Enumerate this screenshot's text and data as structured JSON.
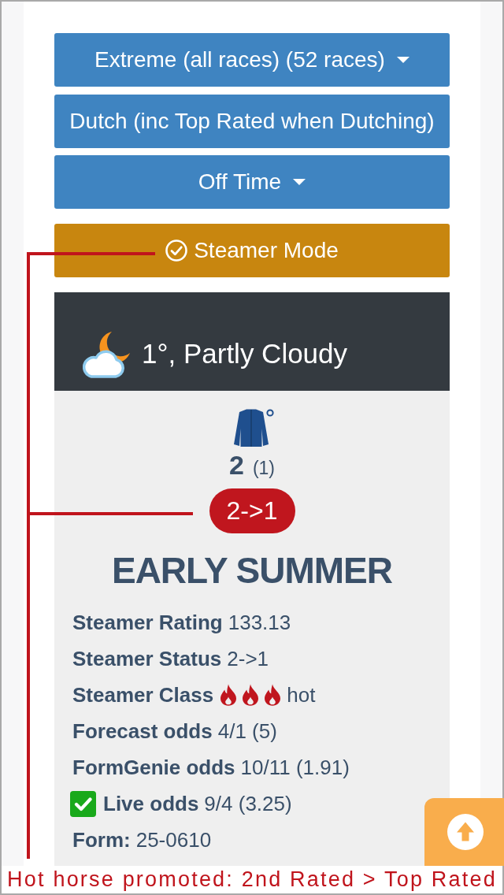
{
  "filters": [
    {
      "kind": "dropdown",
      "label": "Extreme (all races) (52 races)"
    },
    {
      "kind": "button",
      "label": "Dutch (inc Top Rated when Dutching)"
    },
    {
      "kind": "dropdown",
      "label": "Off Time"
    }
  ],
  "mode_button": {
    "label": "Steamer Mode",
    "checked": true
  },
  "weather": {
    "text": "1°, Partly Cloudy"
  },
  "runner": {
    "number": "2",
    "draw": "(1)",
    "status_badge": "2->1",
    "name": "EARLY SUMMER",
    "details": [
      {
        "kind": "text",
        "label": "Steamer Rating",
        "value": "133.13"
      },
      {
        "kind": "text",
        "label": "Steamer Status",
        "value": "2->1"
      },
      {
        "kind": "flames",
        "label": "Steamer Class",
        "stars": 3,
        "value": "hot"
      },
      {
        "kind": "text",
        "label": "Forecast odds",
        "value": "4/1 (5)"
      },
      {
        "kind": "text",
        "label": "FormGenie odds",
        "value": "10/11 (1.91)"
      },
      {
        "kind": "check",
        "label": "Live odds",
        "checked": true,
        "value": "9/4 (3.25)"
      },
      {
        "kind": "text",
        "label": "Form:",
        "value": "25-0610"
      }
    ]
  },
  "annotation": {
    "caption": "Hot horse promoted: 2nd Rated > Top Rated"
  }
}
